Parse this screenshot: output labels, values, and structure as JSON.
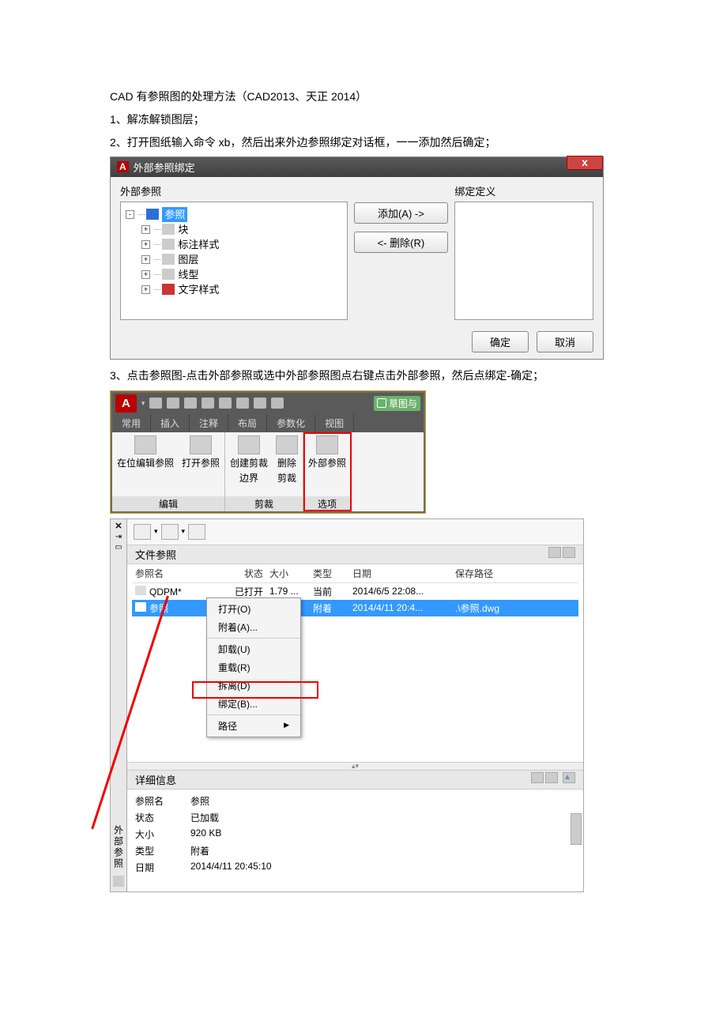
{
  "doc": {
    "p1": "CAD 有参照图的处理方法（CAD2013、天正 2014）",
    "p2": "1、解冻解锁图层；",
    "p3": "2、打开图纸输入命令 xb，然后出来外边参照绑定对话框，一一添加然后确定；",
    "p4": "3、点击参照图-点击外部参照或选中外部参照图点右键点击外部参照，然后点绑定-确定；"
  },
  "dialog1": {
    "title": "外部参照绑定",
    "left_label": "外部参照",
    "right_label": "绑定定义",
    "tree": {
      "root": "参照",
      "items": [
        "块",
        "标注样式",
        "图层",
        "线型",
        "文字样式"
      ]
    },
    "add_btn": "添加(A) ->",
    "remove_btn": "<- 删除(R)",
    "ok": "确定",
    "cancel": "取消"
  },
  "ribbon": {
    "right_tag": "草图与",
    "tabs": [
      "常用",
      "插入",
      "注释",
      "布局",
      "参数化",
      "视图"
    ],
    "panel1": {
      "btn1": "在位编辑参照",
      "btn2": "打开参照",
      "title": "编辑"
    },
    "panel2": {
      "btn1_l1": "创建剪裁",
      "btn1_l2": "边界",
      "btn2_l1": "删除",
      "btn2_l2": "剪裁",
      "title": "剪裁"
    },
    "panel3": {
      "btn1": "外部参照",
      "title": "选项"
    }
  },
  "palette": {
    "side_label": "外部参照",
    "section_files": "文件参照",
    "cols": {
      "c1": "参照名",
      "c2": "状态",
      "c3": "大小",
      "c4": "类型",
      "c5": "日期",
      "c6": "保存路径"
    },
    "rows": [
      {
        "name": "QDPM*",
        "status": "已打开",
        "size": "1.79 ...",
        "type": "当前",
        "date": "2014/6/5 22:08...",
        "path": ""
      },
      {
        "name": "参照",
        "status": "已加载",
        "size": "920 KB",
        "type": "附着",
        "date": "2014/4/11 20:4...",
        "path": ".\\参照.dwg"
      }
    ],
    "context_menu": [
      "打开(O)",
      "附着(A)...",
      "卸载(U)",
      "重载(R)",
      "拆离(D)",
      "绑定(B)...",
      "路径"
    ],
    "section_details": "详细信息",
    "details": [
      {
        "k": "参照名",
        "v": "参照"
      },
      {
        "k": "状态",
        "v": "已加载"
      },
      {
        "k": "大小",
        "v": "920 KB"
      },
      {
        "k": "类型",
        "v": "附着"
      },
      {
        "k": "日期",
        "v": "2014/4/11 20:45:10"
      }
    ]
  }
}
